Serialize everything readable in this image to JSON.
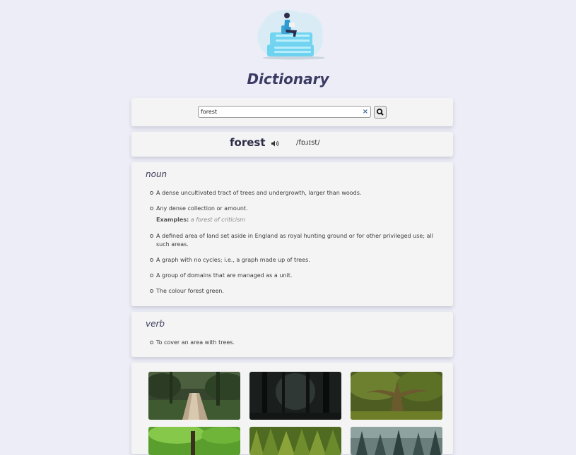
{
  "app": {
    "title": "Dictionary"
  },
  "search": {
    "value": "forest",
    "placeholder": "",
    "clear_icon": "close-icon",
    "submit_icon": "search-icon"
  },
  "entry": {
    "word": "forest",
    "phonetic": "/fɒɹɪst/",
    "audio_icon": "speaker-icon"
  },
  "meanings": [
    {
      "part_of_speech": "noun",
      "definitions": [
        {
          "text": "A dense uncultivated tract of trees and undergrowth, larger than woods."
        },
        {
          "text": "Any dense collection or amount.",
          "examples_label": "Examples:",
          "example": "a forest of criticism"
        },
        {
          "text": "A defined area of land set aside in England as royal hunting ground or for other privileged use; all such areas."
        },
        {
          "text": "A graph with no cycles; i.e., a graph made up of trees."
        },
        {
          "text": "A group of domains that are managed as a unit."
        },
        {
          "text": "The colour forest green."
        }
      ]
    },
    {
      "part_of_speech": "verb",
      "definitions": [
        {
          "text": "To cover an area with trees."
        }
      ]
    }
  ],
  "images": {
    "count": 6,
    "subjects": [
      "forest-path-bridge",
      "dark-forest",
      "mossy-tree",
      "green-forest",
      "pine-forest",
      "misty-forest"
    ]
  }
}
